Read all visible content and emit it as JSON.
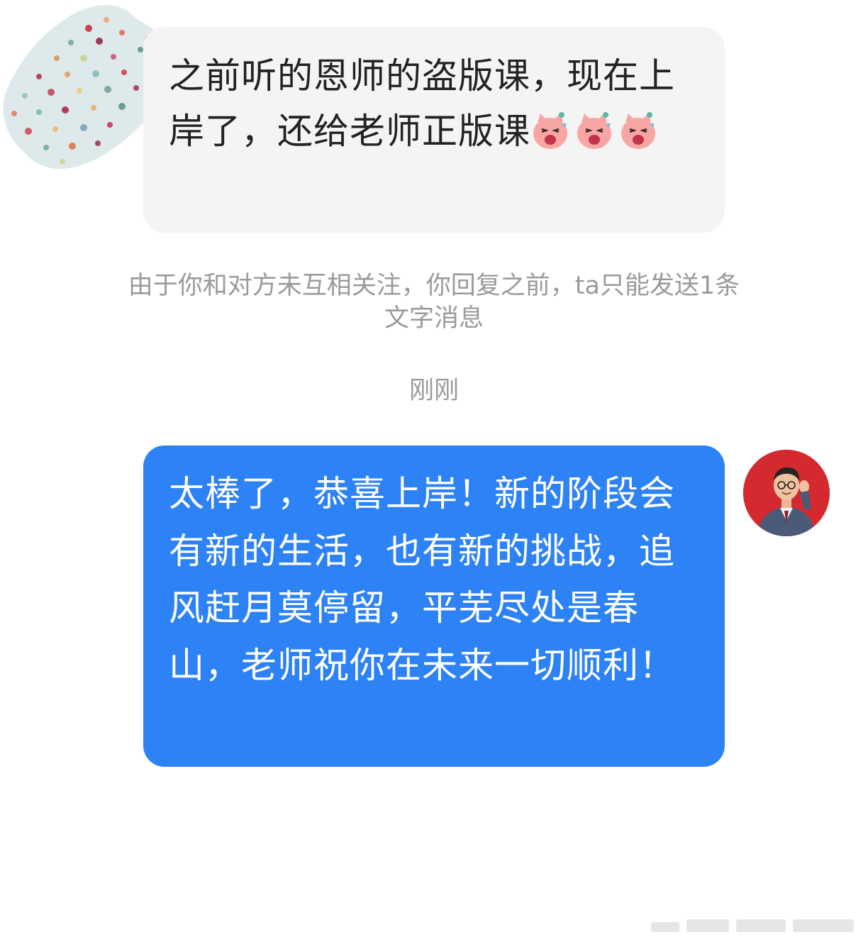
{
  "conversation": {
    "incoming": {
      "avatar": "polka-dot-avatar",
      "text": "之前听的恩师的盗版课，现在上岸了，还给老师正版课",
      "emoji": [
        "laughing-pink-cat-emoji",
        "laughing-pink-cat-emoji",
        "laughing-pink-cat-emoji"
      ]
    },
    "notice": {
      "line1": "由于你和对方未互相关注，你回复之前，ta只能发送1条",
      "line2": "文字消息"
    },
    "timestamp": "刚刚",
    "outgoing": {
      "avatar": "teacher-photo-avatar",
      "text": "太棒了，恭喜上岸！新的阶段会有新的生活，也有新的挑战，追风赶月莫停留，平芜尽处是春山，老师祝你在未来一切顺利！"
    }
  },
  "colors": {
    "incoming_bubble": "#f4f4f4",
    "outgoing_bubble": "#2d82f5",
    "notice_text": "#9a9a9a"
  }
}
